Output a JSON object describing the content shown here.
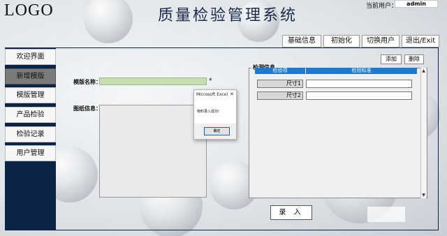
{
  "header": {
    "logo": "LOGO",
    "app_title": "质量检验管理系统",
    "current_user_label": "当前用户：",
    "current_user_value": "admin"
  },
  "toolbar": {
    "buttons": [
      "基础信息",
      "初始化",
      "切换用户",
      "退出/Exit"
    ]
  },
  "sidebar": {
    "items": [
      {
        "label": "欢迎界面",
        "active": false
      },
      {
        "label": "新增模版",
        "active": true
      },
      {
        "label": "模版管理",
        "active": false
      },
      {
        "label": "产品检验",
        "active": false
      },
      {
        "label": "检验记录",
        "active": false
      },
      {
        "label": "用户管理",
        "active": false
      }
    ]
  },
  "form": {
    "template_name_label": "模版名称：",
    "template_name_value": "",
    "required_mark": "*",
    "drawing_label": "图纸信息："
  },
  "inspection": {
    "section_label": "检测信息",
    "add_button": "添加",
    "delete_button": "删除",
    "columns": [
      "检验项",
      "检验标准"
    ],
    "rows": [
      {
        "item": "尺寸1",
        "standard": ""
      },
      {
        "item": "尺寸2",
        "standard": ""
      }
    ]
  },
  "enter_button": "录 入",
  "dialog": {
    "title": "Microsoft Excel",
    "close": "✕",
    "message": "物料录入成功!",
    "ok_button": "确定"
  },
  "colors": {
    "sidebar_bg": "#0c2246",
    "active_nav": "#7b7b7b",
    "name_input_bg": "#c5dfb1",
    "grid_header": "#1e7ad1"
  }
}
